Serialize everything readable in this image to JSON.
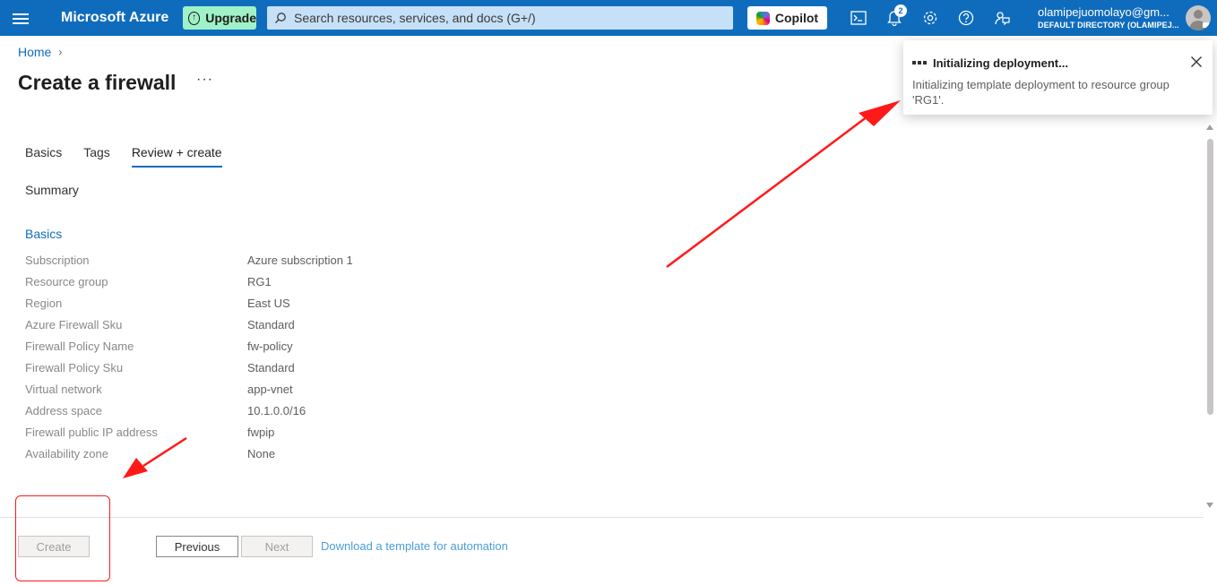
{
  "topbar": {
    "brand": "Microsoft Azure",
    "upgrade_label": "Upgrade",
    "search_placeholder": "Search resources, services, and docs (G+/)",
    "copilot_label": "Copilot",
    "notification_count": "2",
    "account_email": "olamipejuomolayo@gm...",
    "account_directory": "DEFAULT DIRECTORY (OLAMIPEJ..."
  },
  "breadcrumb": {
    "home": "Home"
  },
  "page": {
    "title": "Create a firewall",
    "more": "···"
  },
  "tabs": [
    "Basics",
    "Tags",
    "Review + create"
  ],
  "active_tab": "Review + create",
  "summary_label": "Summary",
  "section": {
    "title": "Basics",
    "rows": [
      {
        "key": "Subscription",
        "value": "Azure subscription 1"
      },
      {
        "key": "Resource group",
        "value": "RG1"
      },
      {
        "key": "Region",
        "value": "East US"
      },
      {
        "key": "Azure Firewall Sku",
        "value": "Standard"
      },
      {
        "key": "Firewall Policy Name",
        "value": "fw-policy"
      },
      {
        "key": "Firewall Policy Sku",
        "value": "Standard"
      },
      {
        "key": "Virtual network",
        "value": "app-vnet"
      },
      {
        "key": "Address space",
        "value": "10.1.0.0/16"
      },
      {
        "key": "Firewall public IP address",
        "value": "fwpip"
      },
      {
        "key": "Availability zone",
        "value": "None"
      }
    ]
  },
  "footer": {
    "create_label": "Create",
    "previous_label": "Previous",
    "next_label": "Next",
    "download_label": "Download a template for automation"
  },
  "notification": {
    "title": "Initializing deployment...",
    "body": "Initializing template deployment to resource group 'RG1'."
  },
  "colors": {
    "accent": "#0f6cbd",
    "upgrade": "#9ff2c8",
    "annotation": "#ff1a1a"
  }
}
